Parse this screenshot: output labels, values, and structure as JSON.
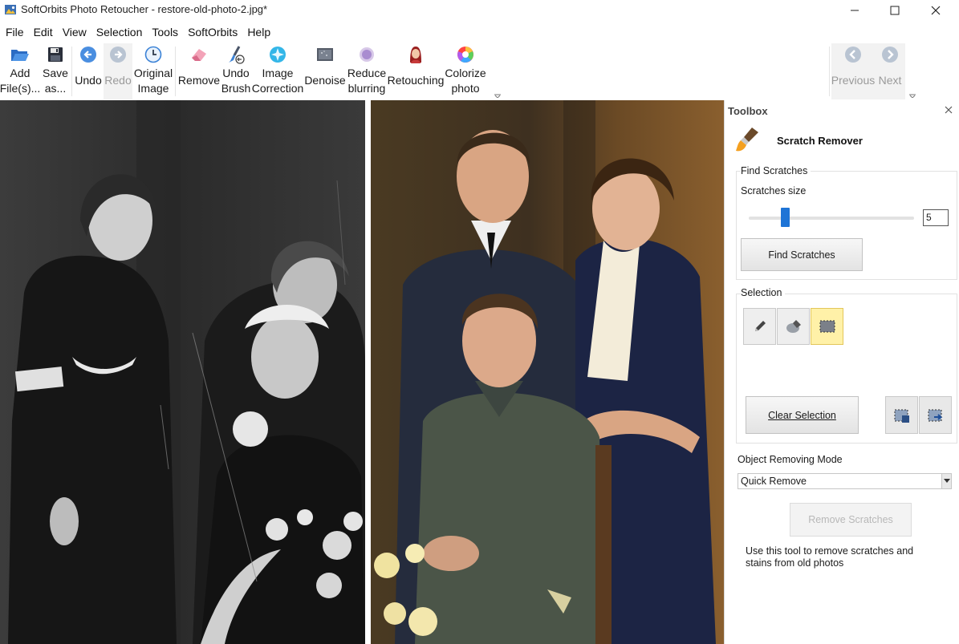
{
  "window": {
    "title": "SoftOrbits Photo Retoucher - restore-old-photo-2.jpg*"
  },
  "menu": [
    "File",
    "Edit",
    "View",
    "Selection",
    "Tools",
    "SoftOrbits",
    "Help"
  ],
  "toolbar": {
    "add_files": [
      "Add",
      "File(s)..."
    ],
    "save_as": [
      "Save",
      "as..."
    ],
    "undo": "Undo",
    "redo": "Redo",
    "original_image": [
      "Original",
      "Image"
    ],
    "remove": "Remove",
    "undo_brush": [
      "Undo",
      "Brush"
    ],
    "image_correction": [
      "Image",
      "Correction"
    ],
    "denoise": "Denoise",
    "reduce_blurring": [
      "Reduce",
      "blurring"
    ],
    "retouching": "Retouching",
    "colorize_photo": [
      "Colorize",
      "photo"
    ],
    "previous": "Previous",
    "next": "Next"
  },
  "toolbox": {
    "header": "Toolbox",
    "tool_name": "Scratch Remover",
    "find_group": {
      "title": "Find Scratches",
      "size_label": "Scratches size",
      "size_value": "5",
      "slider_fraction": 0.22,
      "find_button": "Find Scratches"
    },
    "selection_group": {
      "title": "Selection",
      "clear_button": "Clear Selection"
    },
    "mode": {
      "label": "Object Removing Mode",
      "selected": "Quick Remove"
    },
    "remove_button": "Remove Scratches",
    "help_text": "Use this tool to remove scratches and stains from old photos"
  },
  "colors": {
    "accent": "#1e74d6",
    "active_tool": "#fff1a8"
  }
}
